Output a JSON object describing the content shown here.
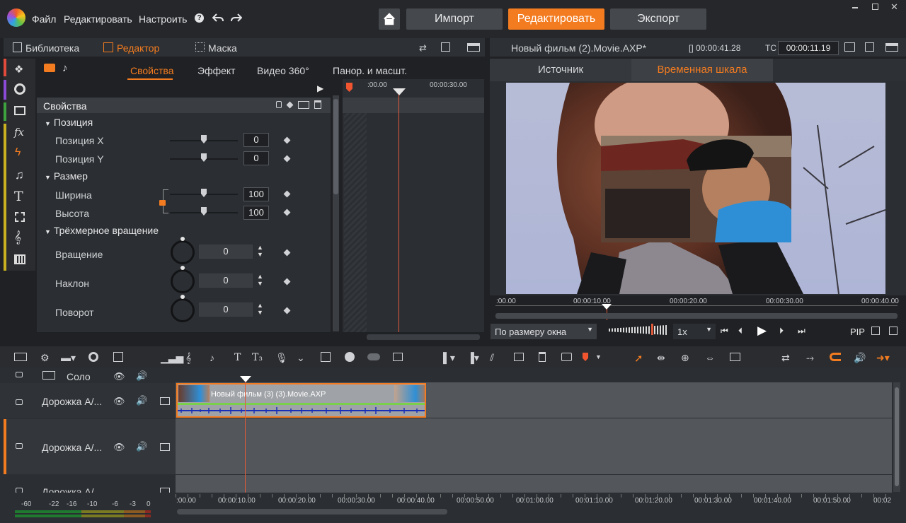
{
  "menu": {
    "file": "Файл",
    "edit": "Редактировать",
    "settings": "Настроить",
    "help": "?"
  },
  "modes": {
    "import": "Импорт",
    "edit": "Редактировать",
    "export": "Экспорт"
  },
  "left_tabs": {
    "library": "Библиотека",
    "editor": "Редактор",
    "mask": "Маска"
  },
  "editor_tabs": {
    "properties": "Свойства",
    "effect": "Эффект",
    "video360": "Видео 360°",
    "pan": "Панор. и масшт."
  },
  "props": {
    "header": "Свойства",
    "position": "Позиция",
    "pos_x": "Позиция X",
    "pos_y": "Позиция Y",
    "pos_x_val": "0",
    "pos_y_val": "0",
    "size": "Размер",
    "width": "Ширина",
    "height": "Высота",
    "width_val": "100",
    "height_val": "100",
    "rotation3d": "Трёхмерное вращение",
    "rotate": "Вращение",
    "tilt": "Наклон",
    "turn": "Поворот",
    "rotate_val": "0",
    "tilt_val": "0",
    "turn_val": "0"
  },
  "mini_timeline": {
    "t0": ":00.00",
    "t30": "00:00:30.00"
  },
  "player": {
    "title": "Новый фильм (2).Movie.AXP*",
    "duration": "[] 00:00:41.28",
    "tc_label": "TC",
    "timecode": "00:00:11.19",
    "tab_source": "Источник",
    "tab_timeline": "Временная шкала",
    "ruler": [
      ":00.00",
      "00:00:10.00",
      "00:00:20.00",
      "00:00:30.00",
      "00:00:40.00"
    ],
    "fit": "По размеру окна",
    "speed": "1x",
    "pip": "PIP"
  },
  "timeline": {
    "solo": "Соло",
    "tracks": [
      "Дорожка А/...",
      "Дорожка А/...",
      "Дорожка А/..."
    ],
    "clip_title": "Новый фильм (3) (3).Movie.AXP",
    "ruler": [
      ":00.00",
      "00:00:10.00",
      "00:00:20.00",
      "00:00:30.00",
      "00:00:40.00",
      "00:00:50.00",
      "00:01:00.00",
      "00:01:10.00",
      "00:01:20.00",
      "00:01:30.00",
      "00:01:40.00",
      "00:01:50.00",
      "00:02"
    ]
  },
  "meter": {
    "labels": [
      "-60",
      "-22",
      "-16",
      "-10",
      "-6",
      "-3",
      "0"
    ]
  },
  "colors": {
    "accent": "#f47c20",
    "panel": "#2b2e32",
    "track": "#53565b"
  }
}
